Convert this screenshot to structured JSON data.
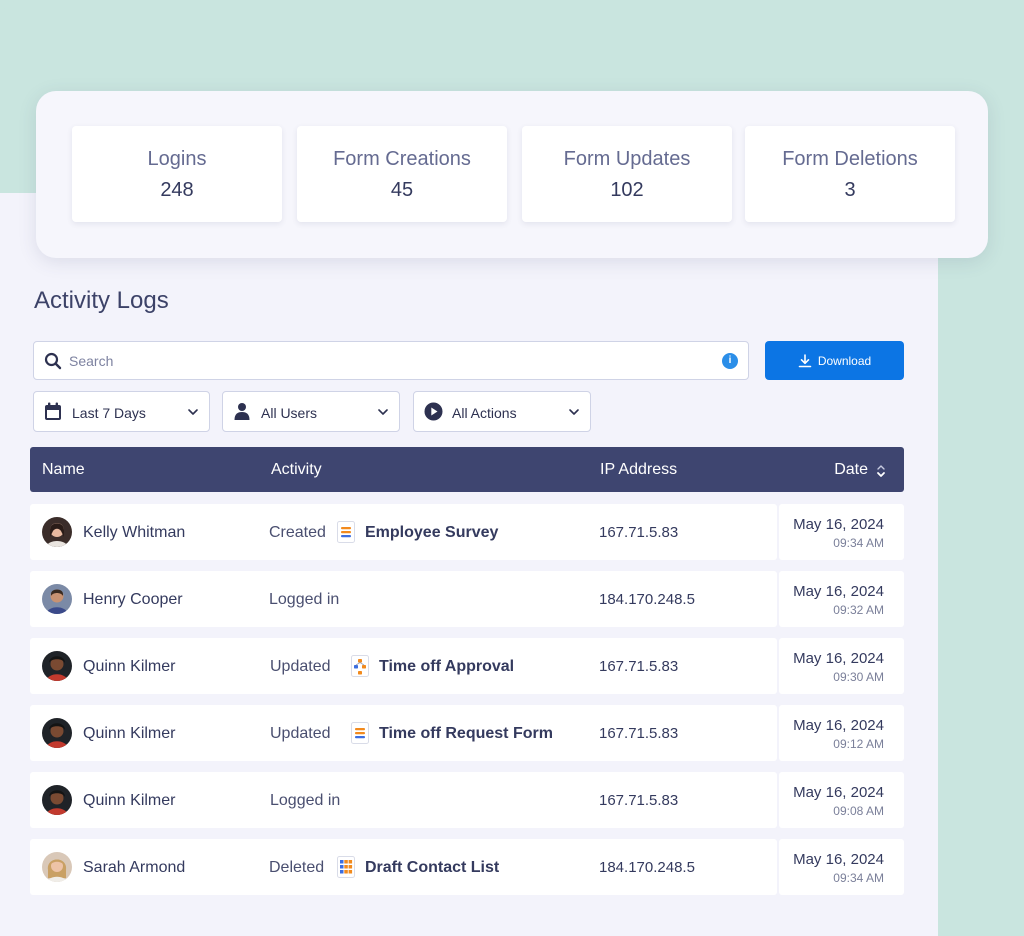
{
  "stats": [
    {
      "label": "Logins",
      "value": "248"
    },
    {
      "label": "Form Creations",
      "value": "45"
    },
    {
      "label": "Form Updates",
      "value": "102"
    },
    {
      "label": "Form Deletions",
      "value": "3"
    }
  ],
  "page_title": "Activity Logs",
  "search": {
    "placeholder": "Search",
    "info_glyph": "i"
  },
  "download_label": "Download",
  "filters": {
    "date": "Last 7 Days",
    "users": "All Users",
    "actions": "All Actions"
  },
  "table": {
    "columns": {
      "name": "Name",
      "activity": "Activity",
      "ip": "IP Address",
      "date": "Date"
    },
    "rows": [
      {
        "name": "Kelly Whitman",
        "action": "Created",
        "form": "Employee Survey",
        "form_icon": "form-icon",
        "ip": "167.71.5.83",
        "date": "May 16, 2024",
        "time": "09:34 AM"
      },
      {
        "name": "Henry Cooper",
        "action": "Logged in",
        "form": "",
        "form_icon": "",
        "ip": "184.170.248.5",
        "date": "May 16, 2024",
        "time": "09:32 AM"
      },
      {
        "name": "Quinn Kilmer",
        "action": "Updated",
        "form": "Time off Approval",
        "form_icon": "approval-flow-icon",
        "ip": "167.71.5.83",
        "date": "May 16, 2024",
        "time": "09:30 AM"
      },
      {
        "name": "Quinn Kilmer",
        "action": "Updated",
        "form": "Time off Request Form",
        "form_icon": "form-icon",
        "ip": "167.71.5.83",
        "date": "May 16, 2024",
        "time": "09:12 AM"
      },
      {
        "name": "Quinn Kilmer",
        "action": "Logged in",
        "form": "",
        "form_icon": "",
        "ip": "167.71.5.83",
        "date": "May 16, 2024",
        "time": "09:08 AM"
      },
      {
        "name": "Sarah Armond",
        "action": "Deleted",
        "form": "Draft Contact List",
        "form_icon": "table-grid-icon",
        "ip": "184.170.248.5",
        "date": "May 16, 2024",
        "time": "09:34 AM"
      }
    ]
  },
  "colors": {
    "header_bg": "#3e4570",
    "download_bg": "#0c75e4",
    "info_blue": "#2b8ee8",
    "accent_mint": "#c9e5df"
  }
}
